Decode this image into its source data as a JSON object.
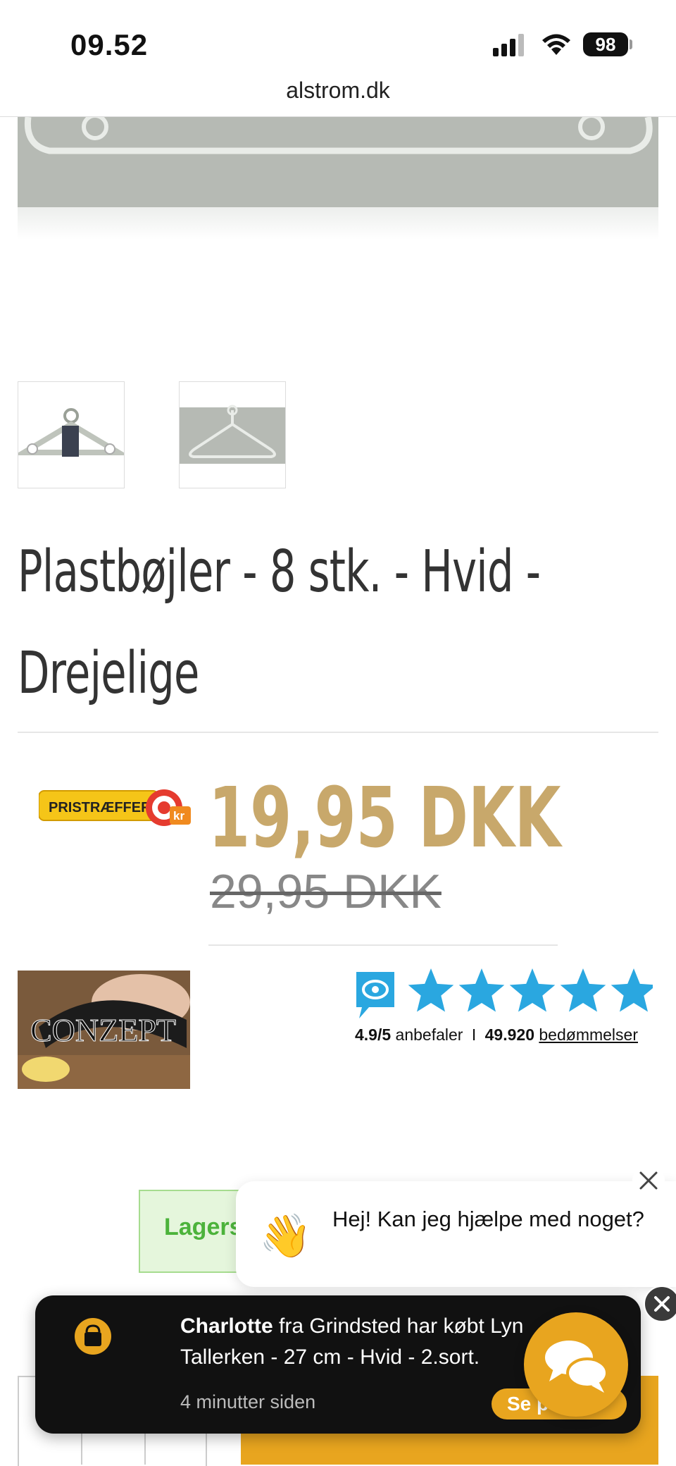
{
  "status_bar": {
    "time": "09.52",
    "battery": "98"
  },
  "browser": {
    "url": "alstrom.dk"
  },
  "product": {
    "title": "Plastbøjler - 8 stk. - Hvid - Drejelige",
    "price_current": "19,95 DKK",
    "price_old": "29,95 DKK",
    "pristraeffer_badge": "PRISTRÆFFER",
    "pristraeffer_kr": "kr",
    "brand_logo_text": "CONZEPT"
  },
  "rating": {
    "score": "4.9/5",
    "recommends": "anbefaler",
    "separator": "I",
    "count": "49.920",
    "reviews_link": "bedømmelser",
    "stars": 5
  },
  "stock": {
    "label": "Lagers"
  },
  "chat": {
    "greeting": "Hej! Kan jeg hjælpe med noget?"
  },
  "toast": {
    "name": "Charlotte",
    "message": " fra Grindsted har købt Lyn Tallerken - 27 cm - Hvid - 2.sort.",
    "time_ago": "4 minutter siden",
    "cta": "Se p"
  },
  "colors": {
    "price_gold": "#c8a86b",
    "accent_orange": "#e8a51f",
    "stock_green": "#4cb33b",
    "rating_blue": "#2aa7e0"
  }
}
